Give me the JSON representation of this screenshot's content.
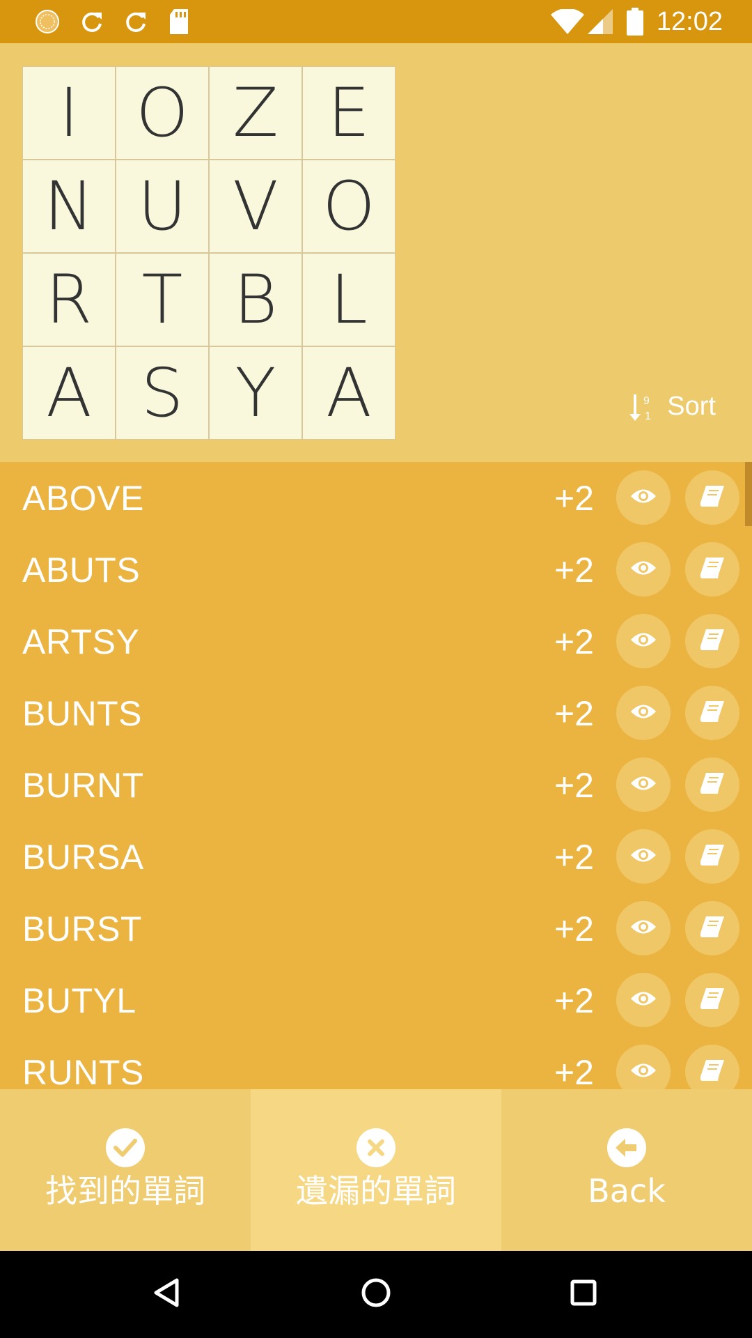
{
  "status_bar": {
    "time": "12:02",
    "icons": [
      "sun-icon",
      "sync-icon",
      "sync-icon",
      "sd-card-icon",
      "wifi-icon",
      "signal-icon",
      "battery-icon"
    ]
  },
  "board": {
    "letters": [
      [
        "I",
        "O",
        "Z",
        "E"
      ],
      [
        "N",
        "U",
        "V",
        "O"
      ],
      [
        "R",
        "T",
        "B",
        "L"
      ],
      [
        "A",
        "S",
        "Y",
        "A"
      ]
    ],
    "sort_label": "Sort",
    "sort_icon": "sort-numeric-icon"
  },
  "words": [
    {
      "word": "ABOVE",
      "score": "+2"
    },
    {
      "word": "ABUTS",
      "score": "+2"
    },
    {
      "word": "ARTSY",
      "score": "+2"
    },
    {
      "word": "BUNTS",
      "score": "+2"
    },
    {
      "word": "BURNT",
      "score": "+2"
    },
    {
      "word": "BURSA",
      "score": "+2"
    },
    {
      "word": "BURST",
      "score": "+2"
    },
    {
      "word": "BUTYL",
      "score": "+2"
    },
    {
      "word": "RUNTS",
      "score": "+2"
    }
  ],
  "tabs": [
    {
      "label": "找到的單詞",
      "icon": "check-circle-icon",
      "active": false
    },
    {
      "label": "遺漏的單詞",
      "icon": "x-circle-icon",
      "active": true
    },
    {
      "label": "Back",
      "icon": "arrow-left-circle-icon",
      "active": false
    }
  ],
  "colors": {
    "status_bar": "#d8960f",
    "board_bg": "#edca6c",
    "cell_bg": "#f9f8dc",
    "list_bg": "#ebb441",
    "button_bg": "#f0c766",
    "tab_bg": "#efcc70",
    "tab_active_bg": "#f6d884"
  }
}
